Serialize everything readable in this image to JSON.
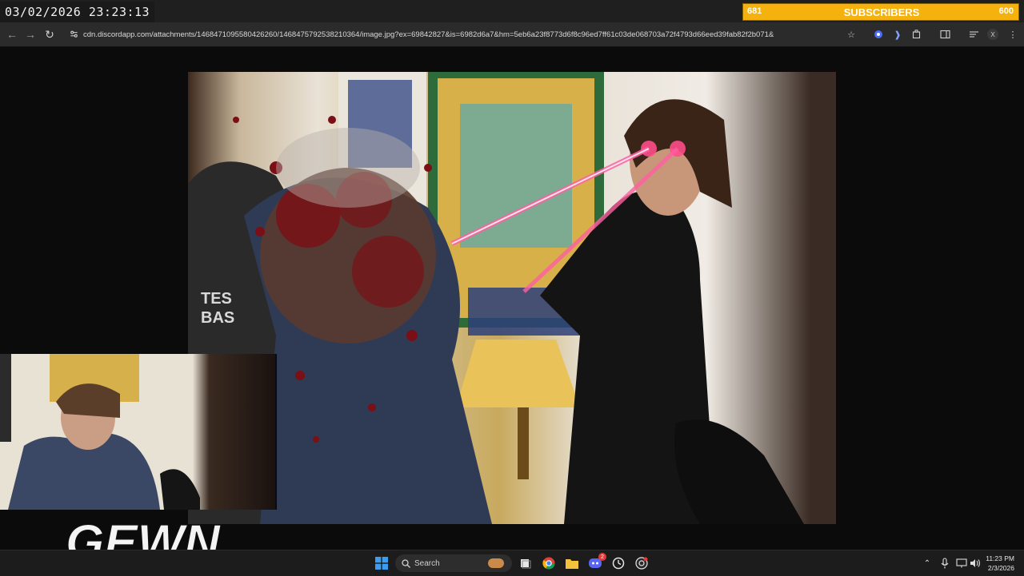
{
  "overlay": {
    "timestamp": "03/02/2026 23:23:13",
    "sub_goal": {
      "current": "681",
      "label": "SUBSCRIBERS",
      "target": "600"
    },
    "logo_text": "GEWN"
  },
  "browser": {
    "url": "cdn.discordapp.com/attachments/1468471095580426260/1468475792538210364/image.jpg?ex=69842827&is=6982d6a7&hm=5eb6a23f8773d6f8c96ed7ff61c03de068703a72f4793d66eed39fab82f2b071&",
    "extension_badge": "X"
  },
  "image": {
    "shirt_text_1": "TES",
    "shirt_text_2": "BAS"
  },
  "taskbar": {
    "search_label": "Search",
    "discord_badge": "2",
    "time": "11:23 PM",
    "date": "2/3/2026"
  },
  "icons": {
    "back": "arrow-left-icon",
    "forward": "arrow-right-icon",
    "reload": "reload-icon",
    "bookmark": "star-icon",
    "windows": "windows-start-icon",
    "search": "search-icon"
  }
}
